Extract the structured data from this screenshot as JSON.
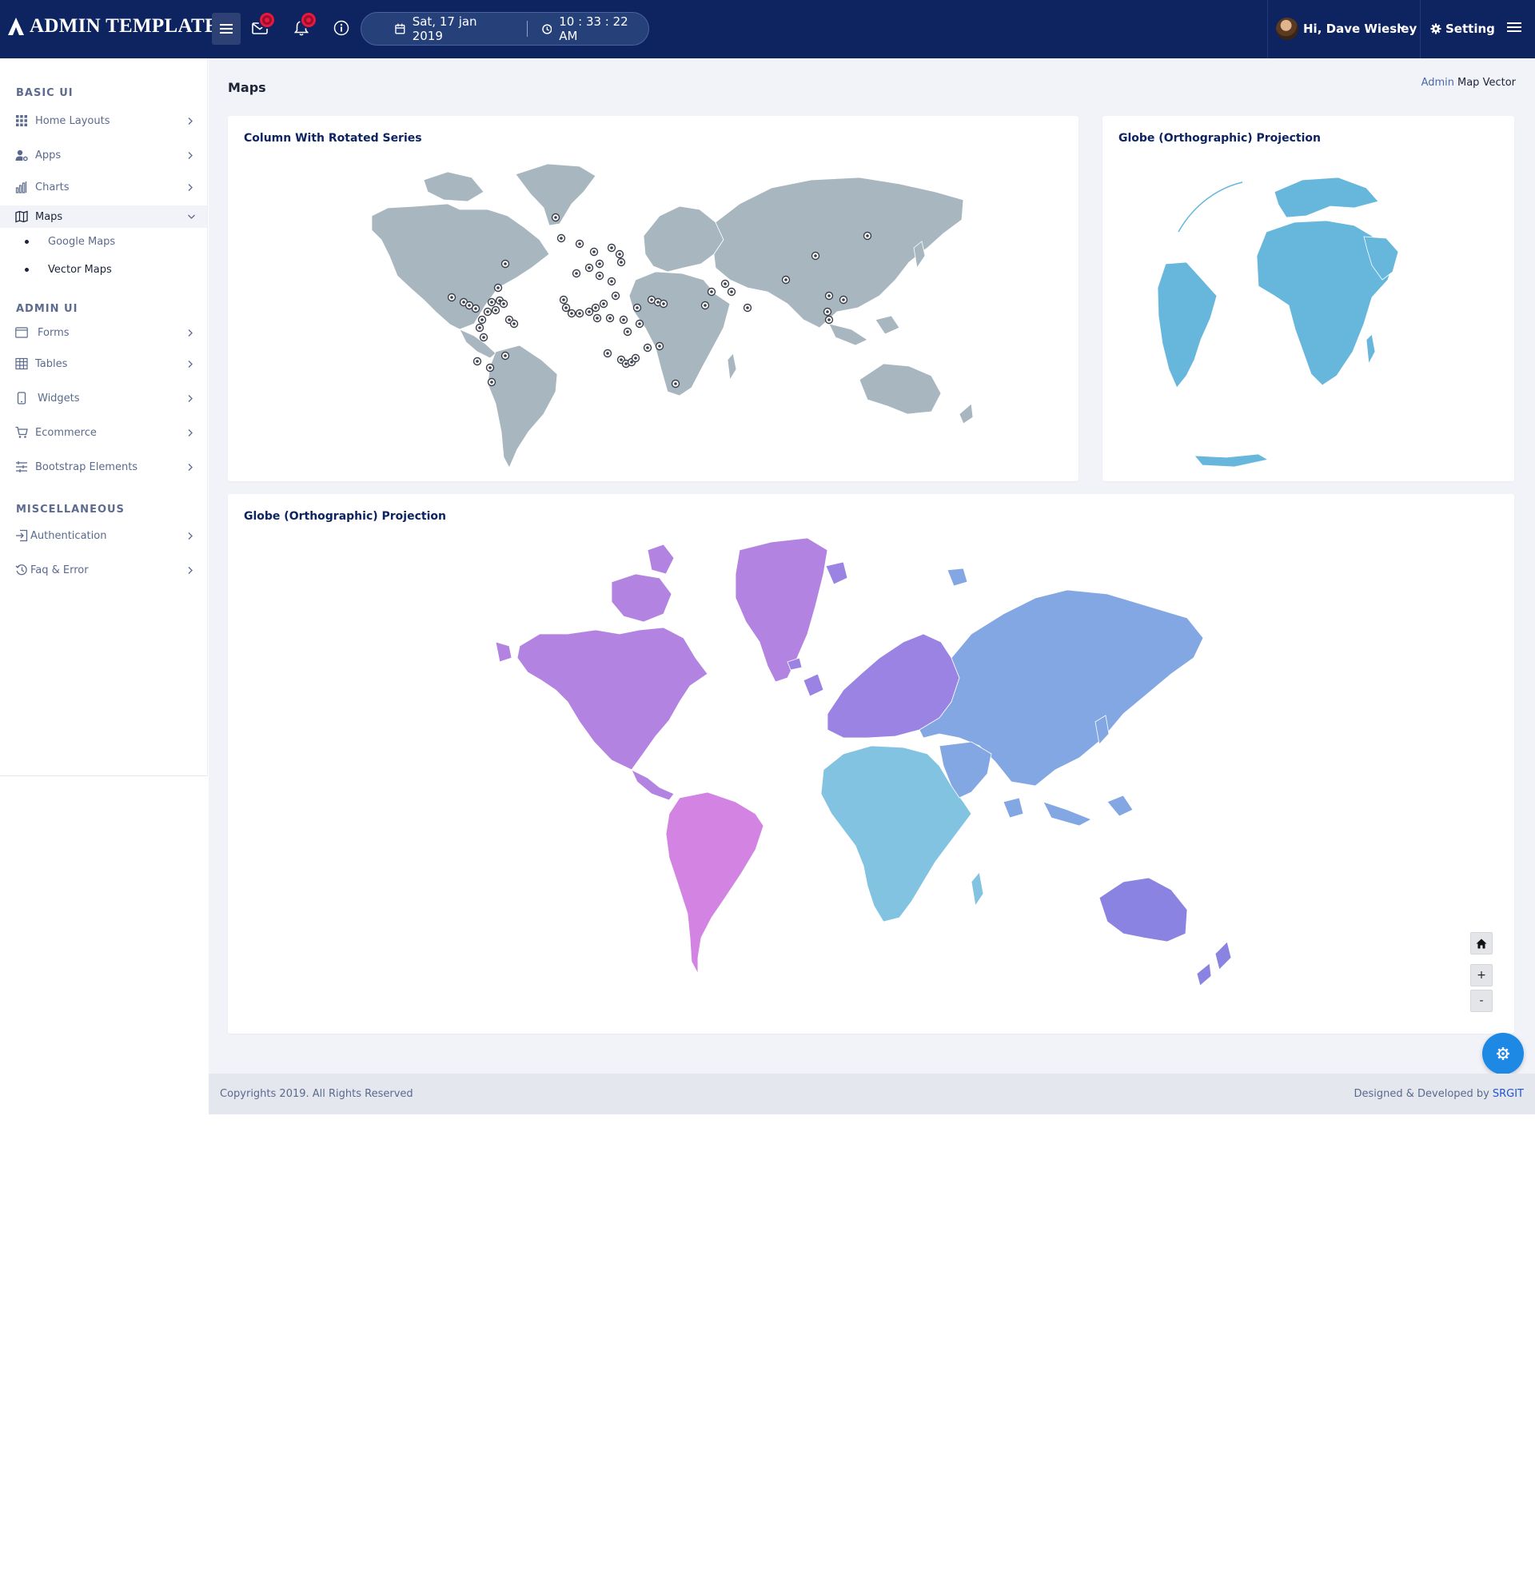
{
  "header": {
    "brand": "ADMIN TEMPLATE",
    "date": "Sat, 17 jan 2019",
    "time": "10 : 33 : 22 AM",
    "user_greeting": "Hi, Dave Wiesley",
    "settings_label": "Setting",
    "icons": [
      "menu-icon",
      "mail-icon",
      "bell-icon",
      "info-icon",
      "calendar-icon",
      "clock-icon",
      "chevron-down-icon",
      "gear-icon",
      "hamburger-icon"
    ]
  },
  "sidebar": {
    "sections": [
      {
        "title": "BASIC UI",
        "items": [
          {
            "label": "Home Layouts",
            "icon": "grid-icon"
          },
          {
            "label": "Apps",
            "icon": "user-cog-icon"
          },
          {
            "label": "Charts",
            "icon": "bar-chart-icon"
          },
          {
            "label": "Maps",
            "icon": "map-icon",
            "expanded": true,
            "children": [
              {
                "label": "Google Maps"
              },
              {
                "label": "Vector Maps",
                "current": true
              }
            ]
          }
        ]
      },
      {
        "title": "ADMIN UI",
        "items": [
          {
            "label": "Forms",
            "icon": "form-icon"
          },
          {
            "label": "Tables",
            "icon": "table-icon"
          },
          {
            "label": "Widgets",
            "icon": "phone-icon"
          },
          {
            "label": "Ecommerce",
            "icon": "cart-icon"
          },
          {
            "label": "Bootstrap Elements",
            "icon": "sliders-icon"
          }
        ]
      },
      {
        "title": "MISCELLANEOUS",
        "items": [
          {
            "label": "Authentication",
            "icon": "login-icon"
          },
          {
            "label": "Faq & Error",
            "icon": "history-icon"
          }
        ]
      }
    ]
  },
  "page": {
    "title": "Maps",
    "breadcrumb": {
      "link": "Admin",
      "current": "Map Vector"
    }
  },
  "cards": {
    "column_rotated": {
      "title": "Column With Rotated Series"
    },
    "globe": {
      "title": "Globe (Orthographic) Projection"
    },
    "world": {
      "title": "Globe (Orthographic) Projection",
      "zoom_in": "+",
      "zoom_out": "-"
    }
  },
  "footer": {
    "copyright": "Copyrights 2019. All Rights Reserved",
    "credit_prefix": "Designed & Developed by",
    "credit_brand": "SRGIT"
  },
  "colors": {
    "header_bg": "#0d2461",
    "land_gray": "#a7b6bf",
    "globe_blue": "#67b7dc",
    "north_america": "#b383e2",
    "south_america": "#d383e2",
    "europe": "#9a83e2",
    "asia": "#83a7e2",
    "africa": "#83c3e2",
    "oceania": "#8a83e2",
    "fab_blue": "#1e88e5"
  }
}
